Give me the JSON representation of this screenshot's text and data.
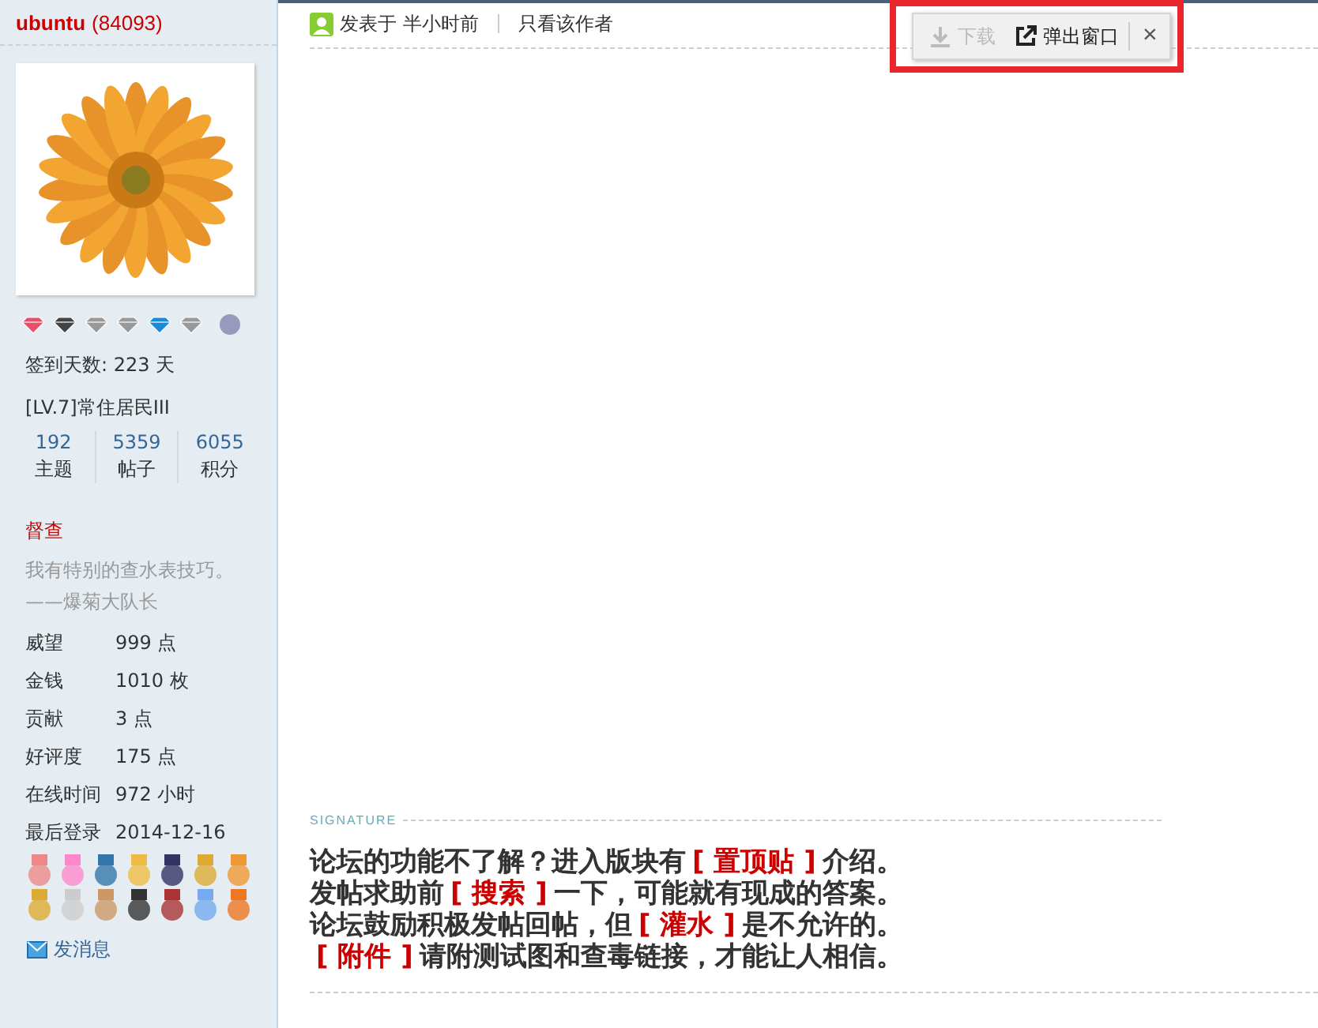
{
  "user": {
    "name": "ubuntu",
    "uid": "(84093)",
    "checkin": "签到天数: 223 天",
    "level": "[LV.7]常住居民III",
    "stats": [
      {
        "value": "192",
        "label": "主题"
      },
      {
        "value": "5359",
        "label": "帖子"
      },
      {
        "value": "6055",
        "label": "积分"
      }
    ],
    "group": "督查",
    "motto": "我有特别的查水表技巧。——爆菊大队长",
    "fields": [
      {
        "label": "威望",
        "value": "999 点"
      },
      {
        "label": "金钱",
        "value": "1010 枚"
      },
      {
        "label": "贡献",
        "value": "3 点"
      },
      {
        "label": "好评度",
        "value": "175 点"
      },
      {
        "label": "在线时间",
        "value": "972 小时"
      },
      {
        "label": "最后登录",
        "value": "2014-12-16"
      }
    ],
    "message_link": "发消息"
  },
  "post": {
    "posted": "发表于 半小时前",
    "author_only": "只看该作者"
  },
  "popup": {
    "download": "下载",
    "download_disabled": true,
    "open_window": "弹出窗口",
    "close": "×"
  },
  "signature": {
    "label": "SIGNATURE",
    "lines": [
      [
        {
          "kind": "plain",
          "text": "论坛的功能不了解？进入版块有"
        },
        {
          "kind": "link",
          "text": "[ 置顶贴 ]"
        },
        {
          "kind": "plain",
          "text": "介绍。"
        }
      ],
      [
        {
          "kind": "plain",
          "text": "发帖求助前"
        },
        {
          "kind": "link",
          "text": "[ 搜索 ]"
        },
        {
          "kind": "plain",
          "text": "一下，可能就有现成的答案。"
        }
      ],
      [
        {
          "kind": "plain",
          "text": "论坛鼓励积极发帖回帖，但"
        },
        {
          "kind": "link",
          "text": "[ 灌水 ]"
        },
        {
          "kind": "plain",
          "text": "是不允许的。"
        }
      ],
      [
        {
          "kind": "link",
          "text": "[ 附件 ]"
        },
        {
          "kind": "plain",
          "text": "请附测试图和查毒链接，才能让人相信。"
        }
      ]
    ]
  }
}
